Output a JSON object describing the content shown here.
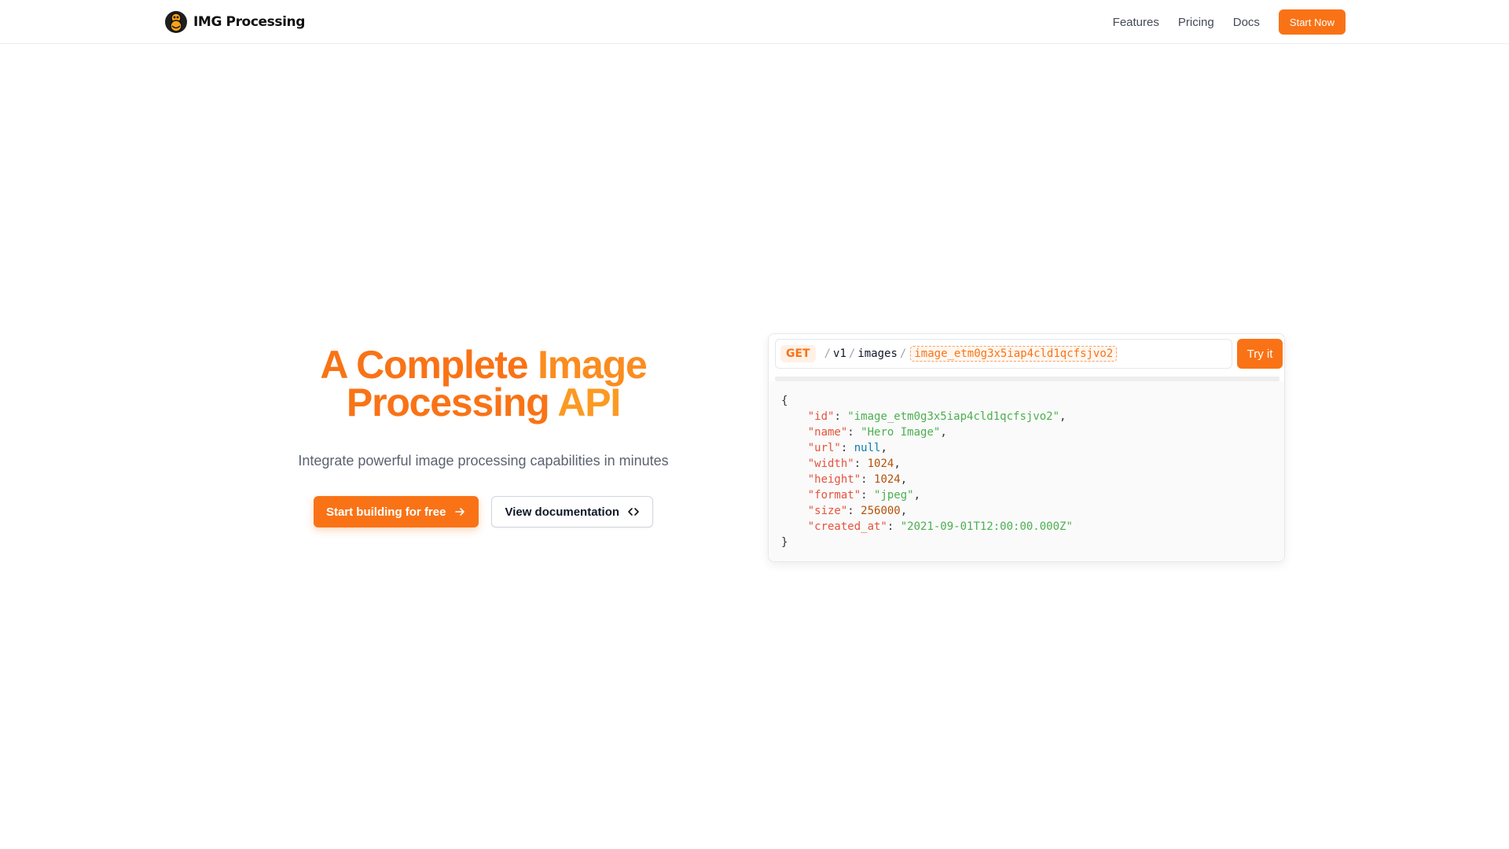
{
  "brand": {
    "name": "IMG Processing",
    "icon": "logo-icon"
  },
  "nav": {
    "links": [
      "Features",
      "Pricing",
      "Docs"
    ],
    "cta_label": "Start Now"
  },
  "hero": {
    "title_line1_a": "A Complete ",
    "title_line1_b": "Image",
    "title_line2_a": "Processing ",
    "title_line2_b": "API",
    "subtitle": "Integrate powerful image processing capabilities in minutes",
    "primary_button": "Start building for free",
    "secondary_button": "View documentation"
  },
  "api": {
    "method": "GET",
    "segments": [
      "v1",
      "images"
    ],
    "id": "image_etm0g3x5iap4cld1qcfsjvo2",
    "try_label": "Try it",
    "response": [
      {
        "key": "\"id\"",
        "value": "\"image_etm0g3x5iap4cld1qcfsjvo2\"",
        "type": "s"
      },
      {
        "key": "\"name\"",
        "value": "\"Hero Image\"",
        "type": "s"
      },
      {
        "key": "\"url\"",
        "value": "null",
        "type": "nl"
      },
      {
        "key": "\"width\"",
        "value": "1024",
        "type": "n"
      },
      {
        "key": "\"height\"",
        "value": "1024",
        "type": "n"
      },
      {
        "key": "\"format\"",
        "value": "\"jpeg\"",
        "type": "s"
      },
      {
        "key": "\"size\"",
        "value": "256000",
        "type": "n"
      },
      {
        "key": "\"created_at\"",
        "value": "\"2021-09-01T12:00:00.000Z\"",
        "type": "s"
      }
    ]
  },
  "colors": {
    "accent": "#f97316"
  }
}
